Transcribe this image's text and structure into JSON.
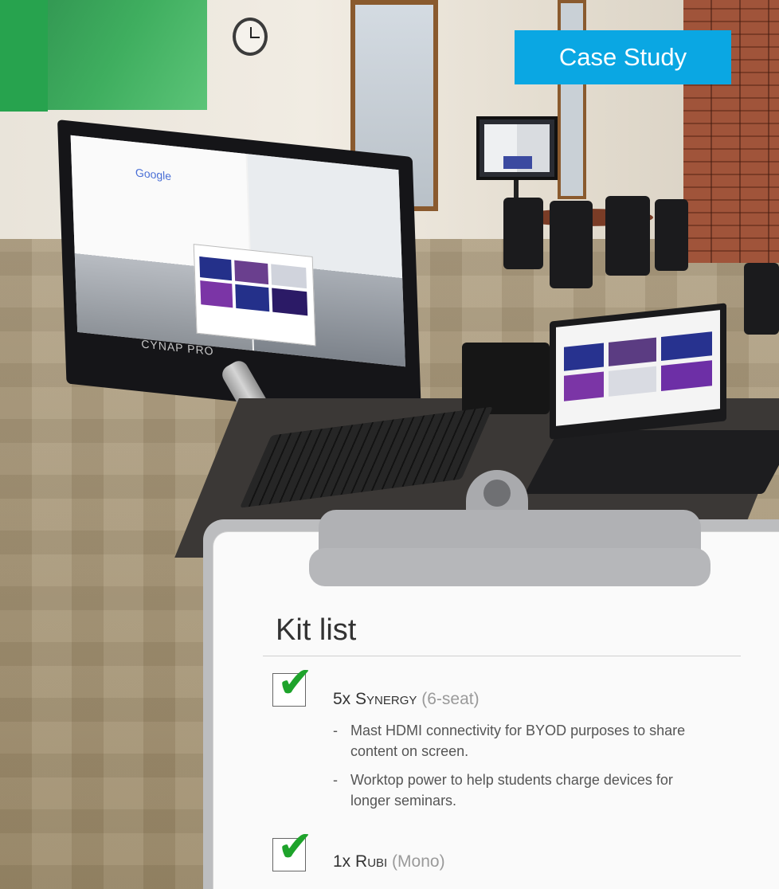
{
  "tag": {
    "label": "Case Study"
  },
  "screen": {
    "search_logo": "Google",
    "brand": "CYNAP PRO"
  },
  "kit": {
    "title": "Kit list",
    "items": [
      {
        "qty": "5x",
        "name": "Synergy",
        "note": "(6-seat)",
        "checked": true,
        "bullets": [
          "Mast HDMI connectivity for BYOD purposes to share content on screen.",
          "Worktop power to help students charge devices for longer seminars."
        ]
      },
      {
        "qty": "1x",
        "name": "Rubi",
        "note": "(Mono)",
        "checked": true,
        "bullets": []
      }
    ]
  },
  "colors": {
    "tag_bg": "#0aa7e3",
    "tick": "#1ea32b",
    "board": "#bcbdbf"
  }
}
